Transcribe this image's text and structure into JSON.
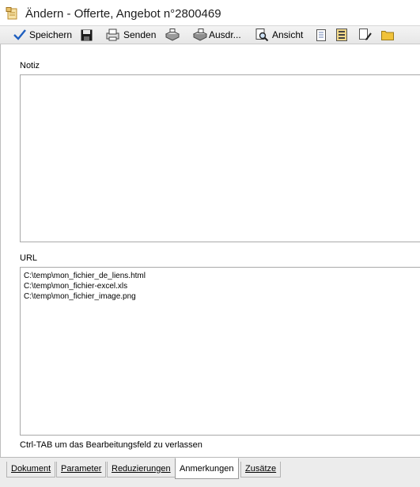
{
  "window": {
    "title": "Ändern - Offerte, Angebot n°2800469"
  },
  "toolbar": {
    "buttons": [
      {
        "label": "Speichern",
        "icon": "checkmark-icon"
      },
      {
        "label": "",
        "icon": "floppy-disk-icon"
      },
      {
        "label": "Senden",
        "icon": "send-printer-icon"
      },
      {
        "label": "",
        "icon": "fax-icon"
      },
      {
        "label": "Ausdr...",
        "icon": "print-icon"
      },
      {
        "label": "Ansicht",
        "icon": "preview-magnifier-icon"
      },
      {
        "label": "",
        "icon": "document-icon"
      },
      {
        "label": "",
        "icon": "documents-list-icon"
      },
      {
        "label": "",
        "icon": "edit-document-icon"
      },
      {
        "label": "",
        "icon": "folder-icon"
      }
    ]
  },
  "form": {
    "notiz_label": "Notiz",
    "notiz_value": "",
    "url_label": "URL",
    "url_lines": [
      "C:\\temp\\mon_fichier_de_liens.html",
      "C:\\temp\\mon_fichier-excel.xls",
      "C:\\temp\\mon_fichier_image.png"
    ],
    "hint": "Ctrl-TAB um das Bearbeitungsfeld zu verlassen"
  },
  "tabs": [
    {
      "label": "Dokument",
      "active": false
    },
    {
      "label": "Parameter",
      "active": false
    },
    {
      "label": "Reduzierungen",
      "active": false
    },
    {
      "label": "Anmerkungen",
      "active": true
    },
    {
      "label": "Zusätze",
      "active": false
    }
  ],
  "colors": {
    "toolbar_bg": "#ececec",
    "checkmark": "#1f5fbf",
    "folder": "#f0c23a"
  }
}
